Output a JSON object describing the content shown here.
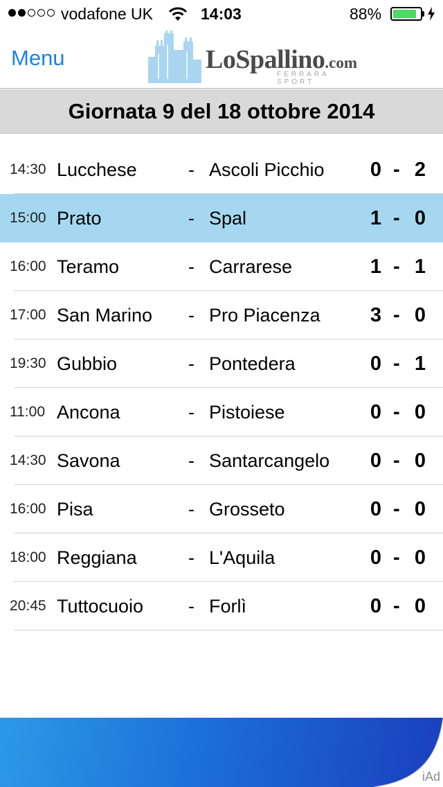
{
  "status_bar": {
    "carrier": "vodafone UK",
    "time": "14:03",
    "battery": "88%",
    "signal_bars": 2
  },
  "nav": {
    "menu_label": "Menu",
    "logo_main": "LoSpallino",
    "logo_domain": ".com",
    "logo_sub": "FERRARA SPORT"
  },
  "round": {
    "title": "Giornata 9 del 18 ottobre 2014"
  },
  "colors": {
    "accent": "#1a82e6",
    "highlight_row": "#a5d8f0",
    "battery": "#4cd964"
  },
  "matches": [
    {
      "time": "14:30",
      "home": "Lucchese",
      "sep": "-",
      "away": "Ascoli Picchio",
      "score_home": "0",
      "score_sep": "-",
      "score_away": "2"
    },
    {
      "time": "15:00",
      "home": "Prato",
      "sep": "-",
      "away": "Spal",
      "score_home": "1",
      "score_sep": "-",
      "score_away": "0"
    },
    {
      "time": "16:00",
      "home": "Teramo",
      "sep": "-",
      "away": "Carrarese",
      "score_home": "1",
      "score_sep": "-",
      "score_away": "1"
    },
    {
      "time": "17:00",
      "home": "San Marino",
      "sep": "-",
      "away": "Pro Piacenza",
      "score_home": "3",
      "score_sep": "-",
      "score_away": "0"
    },
    {
      "time": "19:30",
      "home": "Gubbio",
      "sep": "-",
      "away": "Pontedera",
      "score_home": "0",
      "score_sep": "-",
      "score_away": "1"
    },
    {
      "time": "11:00",
      "home": "Ancona",
      "sep": "-",
      "away": "Pistoiese",
      "score_home": "0",
      "score_sep": "-",
      "score_away": "0"
    },
    {
      "time": "14:30",
      "home": "Savona",
      "sep": "-",
      "away": "Santarcangelo",
      "score_home": "0",
      "score_sep": "-",
      "score_away": "0"
    },
    {
      "time": "16:00",
      "home": "Pisa",
      "sep": "-",
      "away": "Grosseto",
      "score_home": "0",
      "score_sep": "-",
      "score_away": "0"
    },
    {
      "time": "18:00",
      "home": "Reggiana",
      "sep": "-",
      "away": "L'Aquila",
      "score_home": "0",
      "score_sep": "-",
      "score_away": "0"
    },
    {
      "time": "20:45",
      "home": "Tuttocuoio",
      "sep": "-",
      "away": "Forlì",
      "score_home": "0",
      "score_sep": "-",
      "score_away": "0"
    }
  ],
  "ad": {
    "label": "iAd"
  }
}
